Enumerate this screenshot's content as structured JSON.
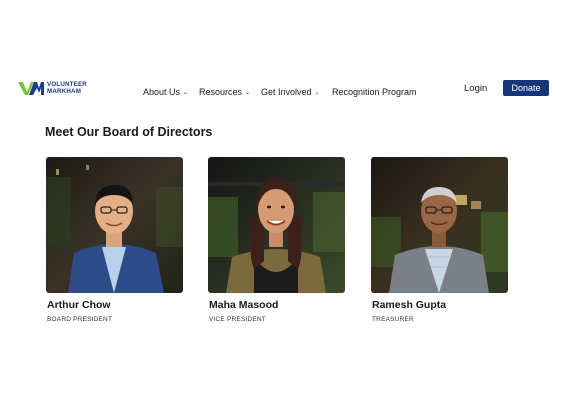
{
  "logo": {
    "line1": "VOLUNTEER",
    "line2": "MARKHAM",
    "icon": "vm-logo-mark",
    "colors": {
      "v": "#7cc242",
      "m": "#1e3a8a"
    }
  },
  "nav": {
    "items": [
      {
        "label": "About Us",
        "has_dropdown": true
      },
      {
        "label": "Resources",
        "has_dropdown": true
      },
      {
        "label": "Get Involved",
        "has_dropdown": true
      },
      {
        "label": "Recognition Program",
        "has_dropdown": false
      }
    ],
    "chevron_glyph": "⌄"
  },
  "header": {
    "login_label": "Login",
    "donate_label": "Donate",
    "accent": "#13377a"
  },
  "section": {
    "title": "Meet Our Board of Directors"
  },
  "board": [
    {
      "name": "Arthur Chow",
      "role": "BOARD PRESIDENT"
    },
    {
      "name": "Maha Masood",
      "role": "VICE PRESIDENT"
    },
    {
      "name": "Ramesh Gupta",
      "role": "TREASURER"
    }
  ]
}
